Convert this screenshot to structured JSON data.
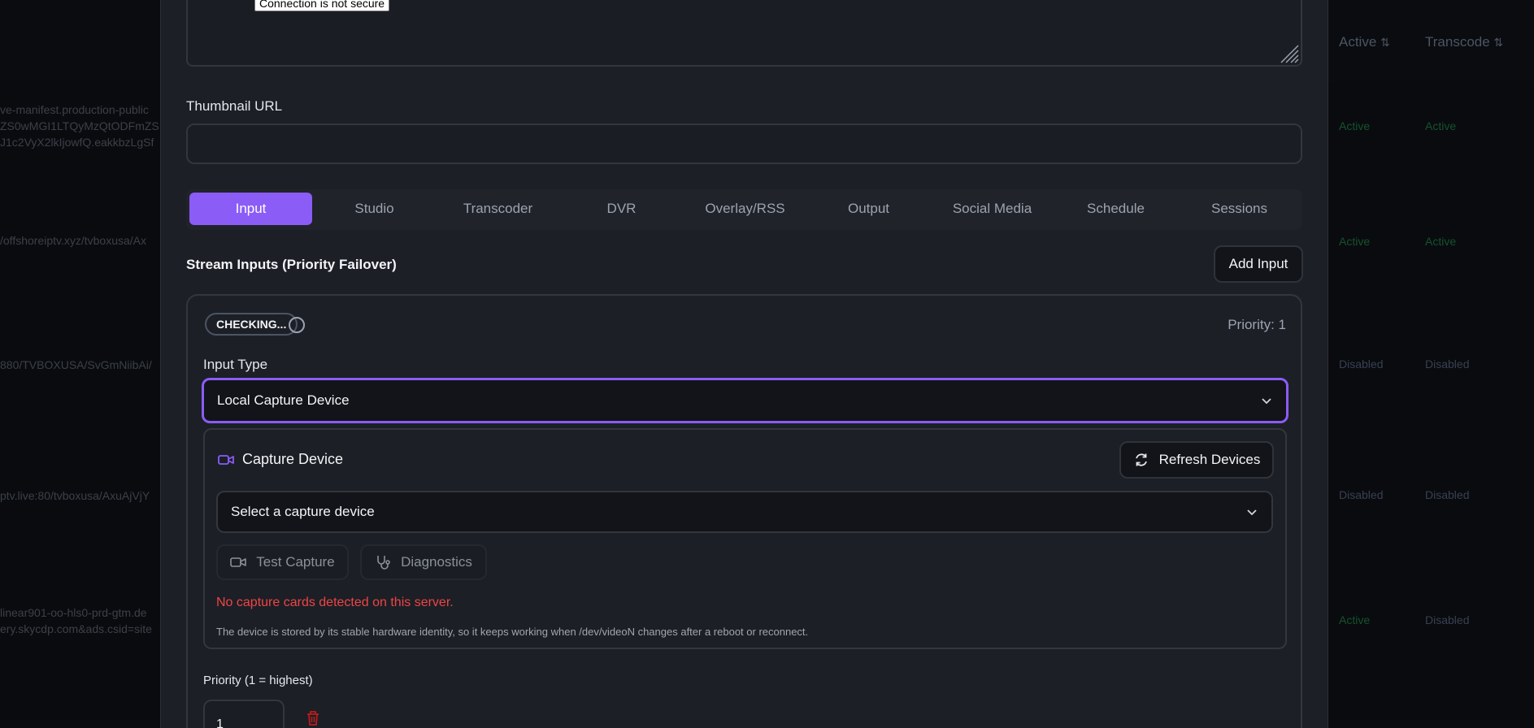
{
  "background": {
    "headers": [
      {
        "label": "Active",
        "sort": "⇅"
      },
      {
        "label": "Transcode",
        "sort": "⇅"
      }
    ],
    "rows": [
      {
        "url_lines": [
          "ve-manifest.production-public",
          "ZS0wMGI1LTQyMzQtODFmZS",
          "J1c2VyX2lkIjowfQ.eakkbzLgSf"
        ],
        "active": "Active",
        "transcode": "Active"
      },
      {
        "url_lines": [
          "/offshoreiptv.xyz/tvboxusa/Ax"
        ],
        "active": "Active",
        "transcode": "Active"
      },
      {
        "url_lines": [
          "880/TVBOXUSA/SvGmNiibAi/"
        ],
        "active": "Disabled",
        "transcode": "Disabled"
      },
      {
        "url_lines": [
          "ptv.live:80/tvboxusa/AxuAjVjY"
        ],
        "active": "Disabled",
        "transcode": "Disabled"
      },
      {
        "url_lines": [
          "linear901-oo-hls0-prd-gtm.de",
          "ery.skycdp.com&ads.csid=site"
        ],
        "active": "Active",
        "transcode": "Disabled"
      }
    ]
  },
  "modal": {
    "tooltip": "Connection is not secure",
    "thumbnail_label": "Thumbnail URL",
    "thumbnail_value": "",
    "tabs": [
      {
        "label": "Input",
        "active": true
      },
      {
        "label": "Studio",
        "active": false
      },
      {
        "label": "Transcoder",
        "active": false
      },
      {
        "label": "DVR",
        "active": false
      },
      {
        "label": "Overlay/RSS",
        "active": false
      },
      {
        "label": "Output",
        "active": false
      },
      {
        "label": "Social Media",
        "active": false
      },
      {
        "label": "Schedule",
        "active": false
      },
      {
        "label": "Sessions",
        "active": false
      }
    ],
    "stream_inputs_title": "Stream Inputs (Priority Failover)",
    "add_input_label": "Add Input",
    "input_card": {
      "status_badge": "CHECKING...",
      "priority_display": "Priority: 1",
      "input_type_label": "Input Type",
      "input_type_value": "Local Capture Device",
      "capture_device_title": "Capture Device",
      "refresh_label": "Refresh Devices",
      "device_select_value": "Select a capture device",
      "test_capture_label": "Test Capture",
      "diagnostics_label": "Diagnostics",
      "error_message": "No capture cards detected on this server.",
      "note": "The device is stored by its stable hardware identity, so it keeps working when /dev/videoN changes after a reboot or reconnect.",
      "priority_label": "Priority (1 = highest)",
      "priority_value": "1"
    }
  },
  "colors": {
    "accent": "#8b5cf6",
    "error": "#ef4444",
    "delete": "#b91c1c"
  }
}
